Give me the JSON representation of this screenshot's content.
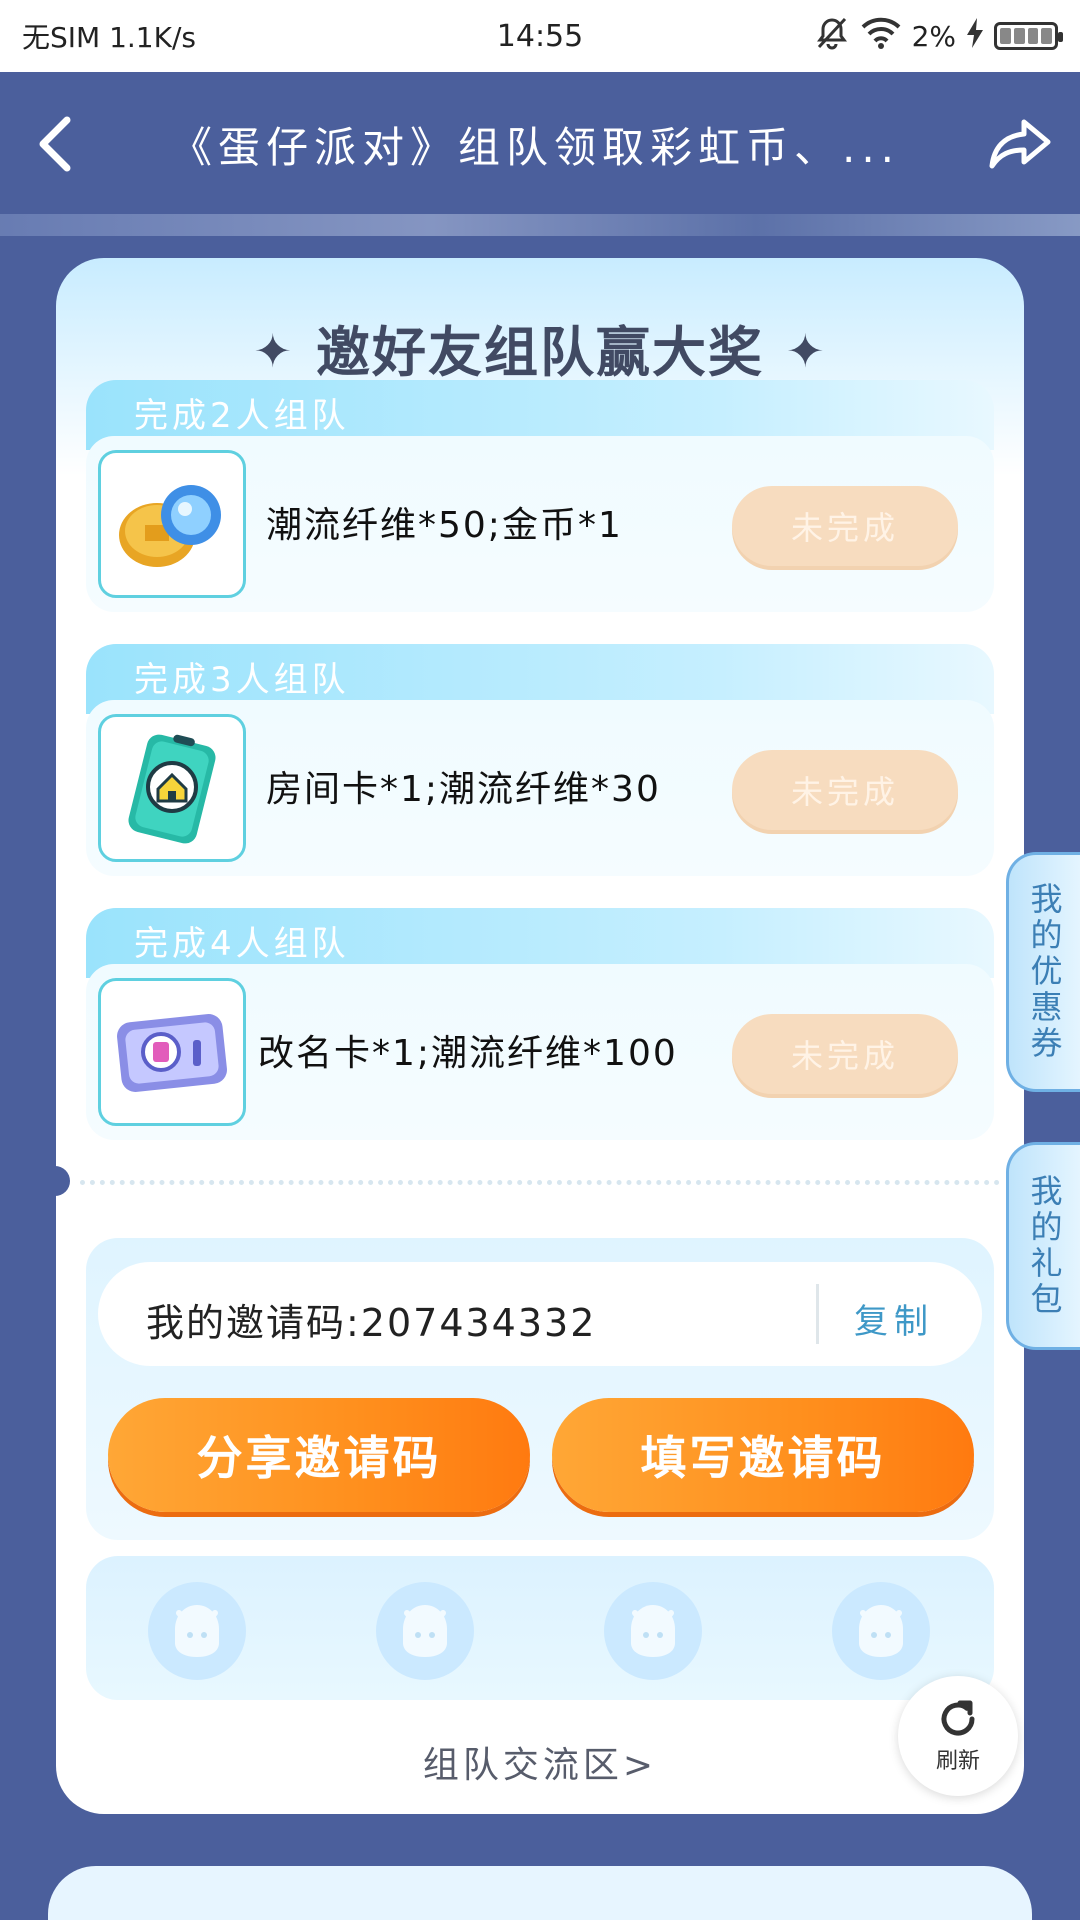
{
  "status_bar": {
    "carrier": "无SIM 1.1K/s",
    "time": "14:55",
    "battery": "2%"
  },
  "header": {
    "title": "《蛋仔派对》组队领取彩虹币、..."
  },
  "card": {
    "heading": "邀好友组队赢大奖",
    "tasks": [
      {
        "label": "完成2人组队",
        "reward": "潮流纤维*50;金币*1",
        "status": "未完成",
        "icon": "coin-and-fiber-icon"
      },
      {
        "label": "完成3人组队",
        "reward": "房间卡*1;潮流纤维*30",
        "status": "未完成",
        "icon": "room-card-icon"
      },
      {
        "label": "完成4人组队",
        "reward": "改名卡*1;潮流纤维*100",
        "status": "未完成",
        "icon": "rename-card-icon"
      }
    ],
    "invite": {
      "code_text": "我的邀请码:207434332",
      "copy_label": "复制",
      "share_label": "分享邀请码",
      "fill_label": "填写邀请码"
    },
    "community_link": "组队交流区>"
  },
  "refresh": {
    "label": "刷新"
  },
  "side_tabs": {
    "coupons": "我的优惠券",
    "gifts": "我的礼包"
  },
  "colors": {
    "page_bg": "#4b5f9c",
    "orange": "#ff8f1d",
    "status_btn": "#f7dcbf",
    "accent_cyan": "#5fd0e0"
  }
}
